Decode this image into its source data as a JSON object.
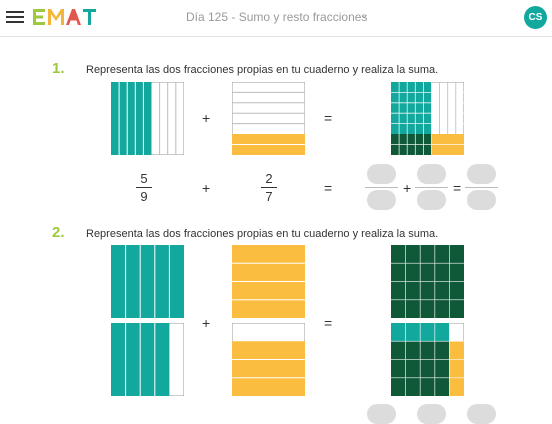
{
  "header": {
    "title": "Día 125 - Sumo y resto fracciones",
    "avatar": "CS",
    "logo_text": "EMAT"
  },
  "colors": {
    "teal": "#13a89e",
    "yellow": "#fbbd3f",
    "green": "#0f5938",
    "accent": "#9ec93a"
  },
  "exercises": [
    {
      "number": "1.",
      "instruction": "Representa las dos fracciones propias en tu cuaderno y realiza la suma.",
      "plus": "+",
      "equals": "=",
      "fraction1": {
        "numerator": "5",
        "denominator": "9"
      },
      "fraction2": {
        "numerator": "2",
        "denominator": "7"
      }
    },
    {
      "number": "2.",
      "instruction": "Representa las dos fracciones propias en tu cuaderno y realiza la suma.",
      "plus": "+",
      "equals": "="
    }
  ],
  "answer_plus": "+",
  "answer_equals": "="
}
